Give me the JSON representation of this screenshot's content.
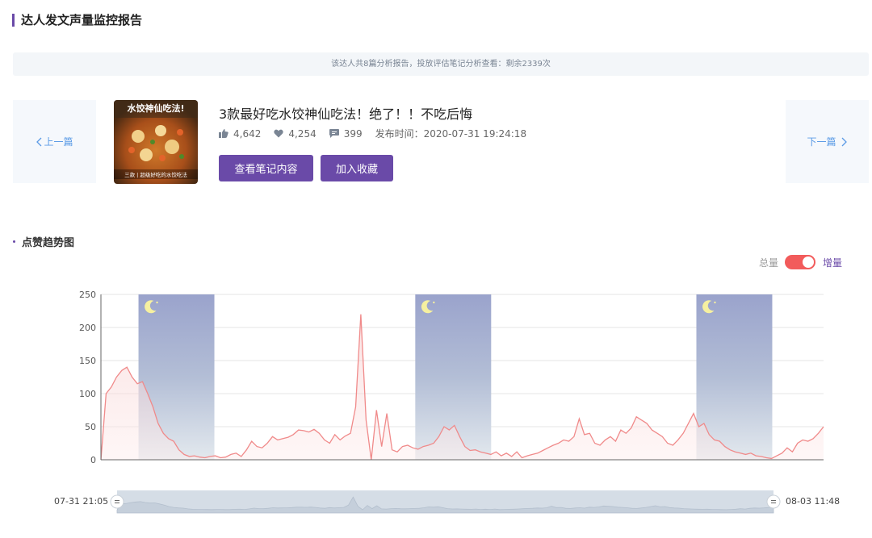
{
  "header": {
    "title": "达人发文声量监控报告"
  },
  "notice": {
    "text": "该达人共8篇分析报告，投放评估笔记分析查看：剩余2339次"
  },
  "nav": {
    "prev_label": "上一篇",
    "next_label": "下一篇"
  },
  "note": {
    "thumb_title": "水饺神仙吃法!",
    "thumb_caption": "三款 | 超级好吃的水饺吃法",
    "title": "3款最好吃水饺神仙吃法！绝了！！不吃后悔",
    "likes": "4,642",
    "favorites": "4,254",
    "comments": "399",
    "publish_time": "发布时间：2020-07-31 19:24:18",
    "view_button": "查看笔记内容",
    "fav_button": "加入收藏"
  },
  "section": {
    "title": "点赞趋势图"
  },
  "toggle": {
    "left_label": "总量",
    "right_label": "增量",
    "state": "on"
  },
  "colors": {
    "accent": "#6a4aa8",
    "line": "#f08a8a",
    "night": "#9aa3cc",
    "link": "#5b9be6"
  },
  "slider": {
    "start_label": "07-31 21:05",
    "end_label": "08-03 11:48"
  },
  "chart_data": {
    "type": "area",
    "title": "",
    "xlabel": "",
    "ylabel": "",
    "ylim": [
      0,
      250
    ],
    "yticks": [
      0,
      50,
      100,
      150,
      200,
      250
    ],
    "x_range": [
      "07-31 21:05",
      "08-03 11:48"
    ],
    "grid": true,
    "night_bands": [
      [
        0.052,
        0.157
      ],
      [
        0.435,
        0.54
      ],
      [
        0.824,
        0.929
      ]
    ],
    "series": [
      {
        "values": [
          0,
          100,
          110,
          125,
          135,
          140,
          125,
          115,
          118,
          100,
          80,
          55,
          40,
          32,
          28,
          15,
          8,
          5,
          6,
          4,
          3,
          5,
          6,
          3,
          4,
          8,
          10,
          5,
          15,
          28,
          20,
          18,
          25,
          35,
          30,
          32,
          34,
          38,
          45,
          44,
          42,
          46,
          40,
          30,
          25,
          38,
          30,
          36,
          40,
          80,
          220,
          60,
          0,
          75,
          20,
          70,
          15,
          12,
          20,
          22,
          18,
          16,
          20,
          22,
          25,
          35,
          50,
          45,
          52,
          35,
          20,
          14,
          15,
          12,
          10,
          8,
          12,
          6,
          10,
          5,
          12,
          3,
          6,
          8,
          10,
          14,
          18,
          22,
          25,
          30,
          28,
          35,
          62,
          38,
          40,
          25,
          22,
          30,
          35,
          28,
          45,
          40,
          48,
          65,
          60,
          55,
          45,
          40,
          35,
          25,
          22,
          30,
          40,
          55,
          70,
          50,
          55,
          38,
          30,
          28,
          20,
          15,
          12,
          10,
          8,
          10,
          6,
          5,
          3,
          2,
          6,
          10,
          18,
          12,
          25,
          30,
          28,
          32,
          40,
          50
        ]
      }
    ]
  }
}
